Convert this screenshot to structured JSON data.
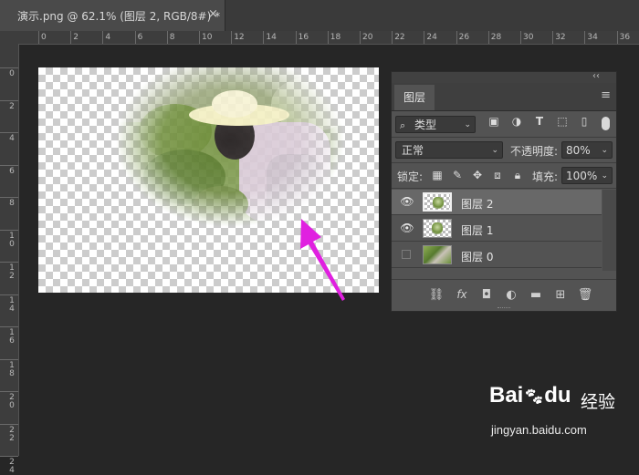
{
  "document_tab": {
    "title": "演示.png @ 62.1% (图层 2, RGB/8#) *",
    "close": "×"
  },
  "ruler_top": {
    "ticks": [
      "0",
      "2",
      "4",
      "6",
      "8",
      "10",
      "12",
      "14",
      "16",
      "18",
      "20",
      "22",
      "24",
      "26",
      "28",
      "30",
      "32",
      "34",
      "36"
    ]
  },
  "ruler_left": {
    "ticks": [
      "0",
      "2",
      "4",
      "6",
      "8",
      "1\n0",
      "1\n2",
      "1\n4",
      "1\n6",
      "1\n8",
      "2\n0",
      "2\n2",
      "2\n4"
    ]
  },
  "layers_panel": {
    "tab_label": "图层",
    "collapse_glyph": "‹‹",
    "menu_glyph": "≡",
    "filter": {
      "icon": "search-icon",
      "value": "类型",
      "filter_icons": [
        "image-filter-icon",
        "adjustment-filter-icon",
        "type-filter-icon",
        "shape-filter-icon",
        "smart-object-filter-icon"
      ]
    },
    "blend_mode": "正常",
    "opacity_label": "不透明度:",
    "opacity_value": "80%",
    "lock_label": "锁定:",
    "lock_icons": [
      "lock-transparent-icon",
      "lock-image-icon",
      "lock-position-icon",
      "lock-artboard-icon",
      "lock-all-icon"
    ],
    "fill_label": "填充:",
    "fill_value": "100%",
    "layers": [
      {
        "name": "图层 2",
        "visible": true,
        "selected": true
      },
      {
        "name": "图层 1",
        "visible": true,
        "selected": false
      },
      {
        "name": "图层 0",
        "visible": false,
        "selected": false
      }
    ],
    "footer_icons": [
      "link-icon",
      "fx-icon",
      "mask-icon",
      "adjustment-icon",
      "folder-icon",
      "new-layer-icon",
      "trash-icon"
    ],
    "footer_glyphs": {
      "link": "⛓",
      "fx": "fx",
      "mask": "◘",
      "adjust": "◐",
      "folder": "▬",
      "new": "⊞",
      "trash": "🗑"
    }
  },
  "annotation": {
    "arrow_color": "#e020e0"
  },
  "watermark": {
    "logo": "Bai",
    "logo_suffix": "du",
    "jingyan": "经验",
    "url": "jingyan.baidu.com"
  }
}
